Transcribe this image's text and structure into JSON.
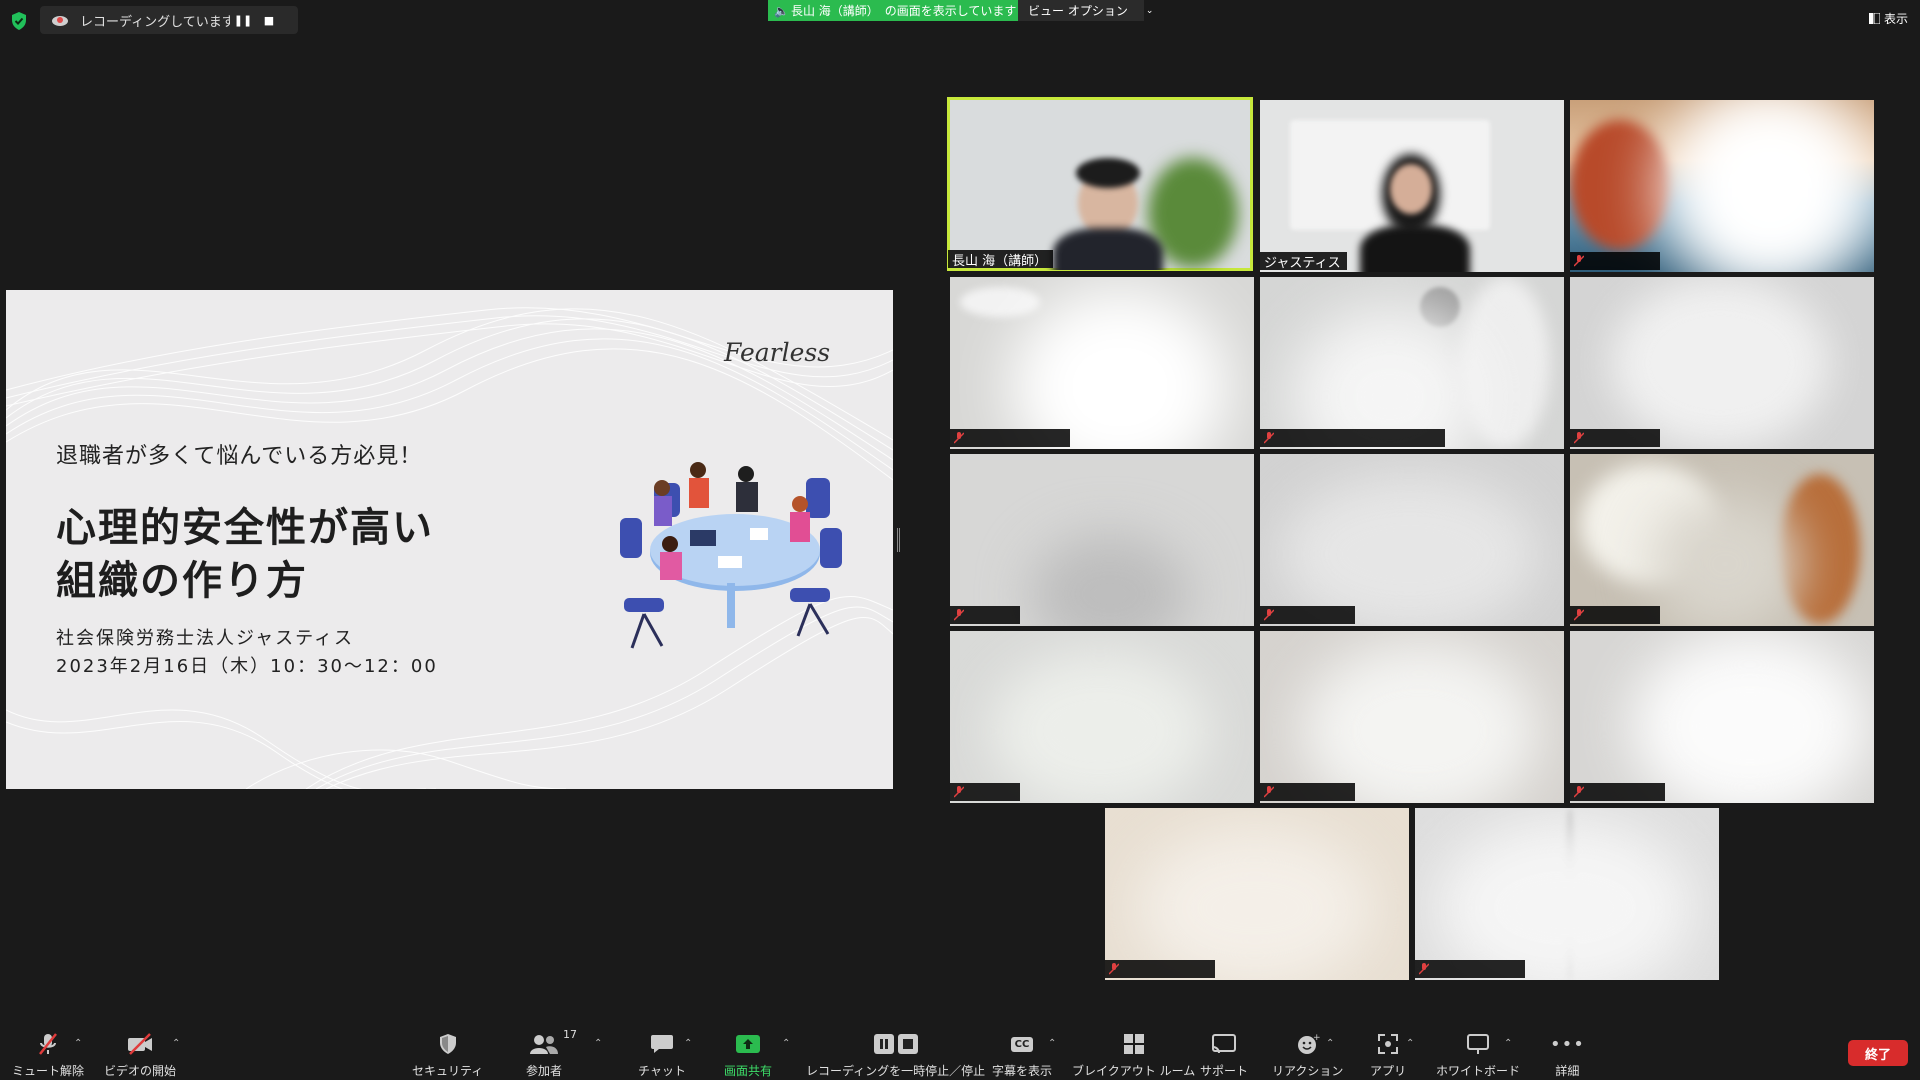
{
  "topbar": {
    "recording_text": "レコーディングしています...",
    "share_banner_prefix": "長山 海（講師）",
    "share_banner_suffix": "の画面を表示しています",
    "view_options": "ビュー オプション",
    "view_button": "表示"
  },
  "slide": {
    "brand": "Fearless",
    "subhead": "退職者が多くて悩んでいる方必見！",
    "title_line1": "心理的安全性が高い",
    "title_line2": "組織の作り方",
    "organizer": "社会保険労務士法人ジャスティス",
    "datetime": "2023年2月16日（木）10：30〜12：00"
  },
  "participants": {
    "host_name": "長山 海（講師）",
    "second_name": "ジャスティス"
  },
  "toolbar": {
    "unmute": "ミュート解除",
    "start_video": "ビデオの開始",
    "security": "セキュリティ",
    "participants": "参加者",
    "participant_count": "17",
    "chat": "チャット",
    "share_screen": "画面共有",
    "pause_recording": "レコーディングを一時停止／停止",
    "captions_icon": "CC",
    "captions": "字幕を表示",
    "breakout": "ブレイクアウト ルーム",
    "support": "サポート",
    "reactions": "リアクション",
    "apps": "アプリ",
    "whiteboard": "ホワイトボード",
    "more": "詳細",
    "end": "終了"
  },
  "colors": {
    "share_green": "#2bbb4f",
    "active_speaker": "#c7e83b",
    "end_red": "#d82c2c"
  }
}
